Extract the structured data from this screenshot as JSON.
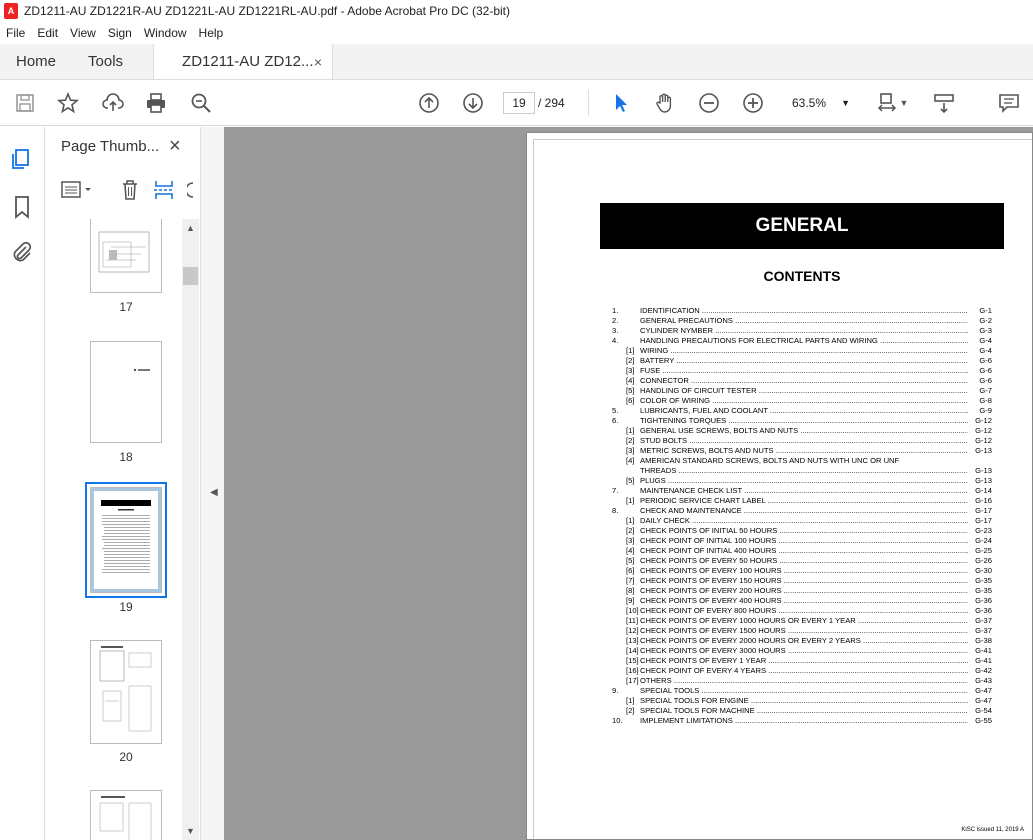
{
  "window": {
    "title": "ZD1211-AU ZD1221R-AU ZD1221L-AU ZD1221RL-AU.pdf - Adobe Acrobat Pro DC (32-bit)"
  },
  "menu": [
    "File",
    "Edit",
    "View",
    "Sign",
    "Window",
    "Help"
  ],
  "tabs": {
    "home": "Home",
    "tools": "Tools",
    "doc": "ZD1211-AU ZD12...",
    "close": "×"
  },
  "toolbar": {
    "page_current": "19",
    "page_total": "/ 294",
    "zoom": "63.5%"
  },
  "panel": {
    "title": "Page Thumb...",
    "close": "×",
    "thumbs": [
      {
        "num": "17"
      },
      {
        "num": "18"
      },
      {
        "num": "19"
      },
      {
        "num": "20"
      }
    ]
  },
  "document": {
    "heading": "GENERAL",
    "contents_title": "CONTENTS",
    "toc": [
      {
        "n": "1.",
        "s": "",
        "t": "IDENTIFICATION",
        "p": "G-1"
      },
      {
        "n": "2.",
        "s": "",
        "t": "GENERAL PRECAUTIONS",
        "p": "G-2"
      },
      {
        "n": "3.",
        "s": "",
        "t": "CYLINDER NYMBER",
        "p": "G-3"
      },
      {
        "n": "4.",
        "s": "",
        "t": "HANDLING PRECAUTIONS FOR ELECTRICAL PARTS AND WIRING",
        "p": "G-4"
      },
      {
        "n": "",
        "s": "[1]",
        "t": "WIRING",
        "p": "G-4"
      },
      {
        "n": "",
        "s": "[2]",
        "t": "BATTERY",
        "p": "G-6"
      },
      {
        "n": "",
        "s": "[3]",
        "t": "FUSE",
        "p": "G-6"
      },
      {
        "n": "",
        "s": "[4]",
        "t": "CONNECTOR",
        "p": "G-6"
      },
      {
        "n": "",
        "s": "[5]",
        "t": "HANDLING OF CIRCUIT TESTER",
        "p": "G-7"
      },
      {
        "n": "",
        "s": "[6]",
        "t": "COLOR OF WIRING",
        "p": "G-8"
      },
      {
        "n": "5.",
        "s": "",
        "t": "LUBRICANTS, FUEL AND COOLANT",
        "p": "G-9"
      },
      {
        "n": "6.",
        "s": "",
        "t": "TIGHTENING TORQUES",
        "p": "G-12"
      },
      {
        "n": "",
        "s": "[1]",
        "t": "GENERAL USE SCREWS, BOLTS AND NUTS",
        "p": "G-12"
      },
      {
        "n": "",
        "s": "[2]",
        "t": "STUD BOLTS",
        "p": "G-12"
      },
      {
        "n": "",
        "s": "[3]",
        "t": "METRIC SCREWS, BOLTS AND NUTS",
        "p": "G-13"
      },
      {
        "n": "",
        "s": "[4]",
        "t": "AMERICAN STANDARD SCREWS, BOLTS AND NUTS WITH UNC OR UNF",
        "p": "",
        "nodots": true
      },
      {
        "n": "",
        "s": "",
        "t": "THREADS",
        "p": "G-13"
      },
      {
        "n": "",
        "s": "[5]",
        "t": "PLUGS",
        "p": "G-13"
      },
      {
        "n": "7.",
        "s": "",
        "t": "MAINTENANCE CHECK LIST",
        "p": "G-14"
      },
      {
        "n": "",
        "s": "[1]",
        "t": "PERIODIC SERVICE CHART LABEL",
        "p": "G-16"
      },
      {
        "n": "8.",
        "s": "",
        "t": "CHECK AND MAINTENANCE",
        "p": "G-17"
      },
      {
        "n": "",
        "s": "[1]",
        "t": "DAILY CHECK",
        "p": "G-17"
      },
      {
        "n": "",
        "s": "[2]",
        "t": "CHECK POINTS OF INITIAL 50 HOURS",
        "p": "G-23"
      },
      {
        "n": "",
        "s": "[3]",
        "t": "CHECK POINT OF INITIAL 100 HOURS",
        "p": "G-24"
      },
      {
        "n": "",
        "s": "[4]",
        "t": "CHECK POINT OF INITIAL 400 HOURS",
        "p": "G-25"
      },
      {
        "n": "",
        "s": "[5]",
        "t": "CHECK POINTS OF EVERY 50 HOURS",
        "p": "G-26"
      },
      {
        "n": "",
        "s": "[6]",
        "t": "CHECK POINTS OF EVERY 100 HOURS",
        "p": "G-30"
      },
      {
        "n": "",
        "s": "[7]",
        "t": "CHECK POINTS OF EVERY 150 HOURS",
        "p": "G-35"
      },
      {
        "n": "",
        "s": "[8]",
        "t": "CHECK POINTS OF EVERY 200 HOURS",
        "p": "G-35"
      },
      {
        "n": "",
        "s": "[9]",
        "t": "CHECK POINTS OF EVERY 400 HOURS",
        "p": "G-36"
      },
      {
        "n": "",
        "s": "[10]",
        "t": "CHECK POINT OF EVERY 800 HOURS",
        "p": "G-36"
      },
      {
        "n": "",
        "s": "[11]",
        "t": "CHECK POINTS OF EVERY 1000 HOURS OR EVERY 1 YEAR",
        "p": "G-37"
      },
      {
        "n": "",
        "s": "[12]",
        "t": "CHECK POINTS OF EVERY 1500 HOURS",
        "p": "G-37"
      },
      {
        "n": "",
        "s": "[13]",
        "t": "CHECK POINTS OF EVERY 2000 HOURS OR EVERY 2 YEARS",
        "p": "G-38"
      },
      {
        "n": "",
        "s": "[14]",
        "t": "CHECK POINTS OF EVERY 3000 HOURS",
        "p": "G-41"
      },
      {
        "n": "",
        "s": "[15]",
        "t": "CHECK POINTS OF EVERY 1 YEAR",
        "p": "G-41"
      },
      {
        "n": "",
        "s": "[16]",
        "t": "CHECK POINT OF EVERY 4 YEARS",
        "p": "G-42"
      },
      {
        "n": "",
        "s": "[17]",
        "t": "OTHERS",
        "p": "G-43"
      },
      {
        "n": "9.",
        "s": "",
        "t": "SPECIAL TOOLS",
        "p": "G-47"
      },
      {
        "n": "",
        "s": "[1]",
        "t": "SPECIAL TOOLS FOR ENGINE",
        "p": "G-47"
      },
      {
        "n": "",
        "s": "[2]",
        "t": "SPECIAL TOOLS FOR MACHINE",
        "p": "G-54"
      },
      {
        "n": "10.",
        "s": "",
        "t": "IMPLEMENT LIMITATIONS",
        "p": "G-55"
      }
    ],
    "footer": "KiSC issued 11, 2019 A"
  },
  "colors": {
    "accent": "#1473e6",
    "viewer_bg": "#9a9a9a"
  }
}
